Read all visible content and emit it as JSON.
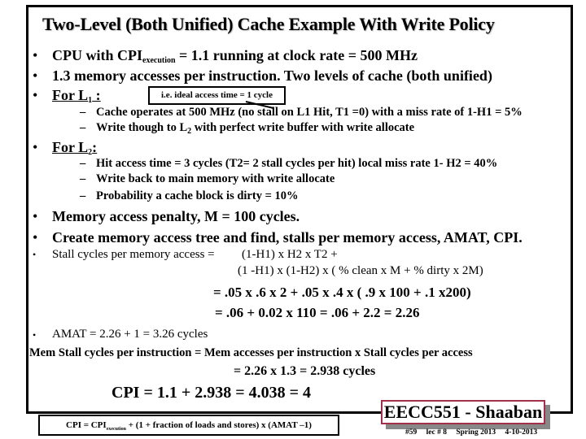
{
  "slide": {
    "title": "Two-Level (Both Unified) Cache Example With Write Policy",
    "bullet_char": "•",
    "dash_char": "–",
    "intro": [
      {
        "pre": "CPU with CPI",
        "sub": "execution",
        "post": " = 1.1  running at clock rate = 500 MHz"
      },
      {
        "text": "1.3 memory accesses per instruction.  Two levels of cache (both unified)"
      }
    ],
    "l1": {
      "heading": "For L",
      "heading_sub": "1",
      "heading_post": " :",
      "note": "i.e. ideal access time = 1 cycle",
      "items": [
        {
          "text": "Cache operates at 500 MHz (no stall on L1 Hit, T1 =0) with a miss rate of  1-H1 =  5%"
        },
        {
          "pre": "Write though to L",
          "sub": "2",
          "post": " with perfect write buffer with write allocate"
        }
      ]
    },
    "l2": {
      "heading": "For L",
      "heading_sub": "2",
      "heading_post": ":",
      "items": [
        "Hit access time = 3 cycles (T2= 2 stall cycles per hit) local miss rate  1- H2 = 40%",
        "Write back to main memory with write allocate",
        "Probability a cache block is dirty = 10%"
      ]
    },
    "penalty": "Memory access penalty,  M = 100 cycles.",
    "task": "Create memory access tree and find, stalls per memory access,  AMAT, CPI.",
    "stall": {
      "label": "Stall cycles per memory access =",
      "line1": "(1-H1) x H2 x T2 +",
      "line2": "(1 -H1)  x (1-H2)  x ( % clean  x M  +  % dirty x 2M)",
      "line3": "=  .05 x .6  x 2  +  .05 x .4 x ( .9 x 100 + .1 x200)",
      "line4": "=   .06 +   0.02 x 110 = .06 + 2.2 =  2.26"
    },
    "amat": "AMAT = 2.26 + 1 = 3.26 cycles",
    "mem_stall": {
      "line1": "Mem Stall cycles per instruction =  Mem accesses per instruction  x  Stall cycles per access",
      "line2": "=     2.26  x  1.3  =    2.938 cycles"
    },
    "cpi_result": "CPI = 1.1 + 2.938 = 4.038 = 4",
    "cpi_formula": {
      "pre": "CPI = CPI",
      "sub": "execution",
      "post": " +  (1 + fraction of loads and stores) x (AMAT –1)"
    },
    "badge": "EECC551 - Shaaban",
    "footer": [
      "#59",
      "lec # 8",
      "Spring 2013",
      "4-10-2013"
    ],
    "colors": {
      "badge_border": "#a3304a",
      "badge_shadow": "#888888"
    }
  }
}
